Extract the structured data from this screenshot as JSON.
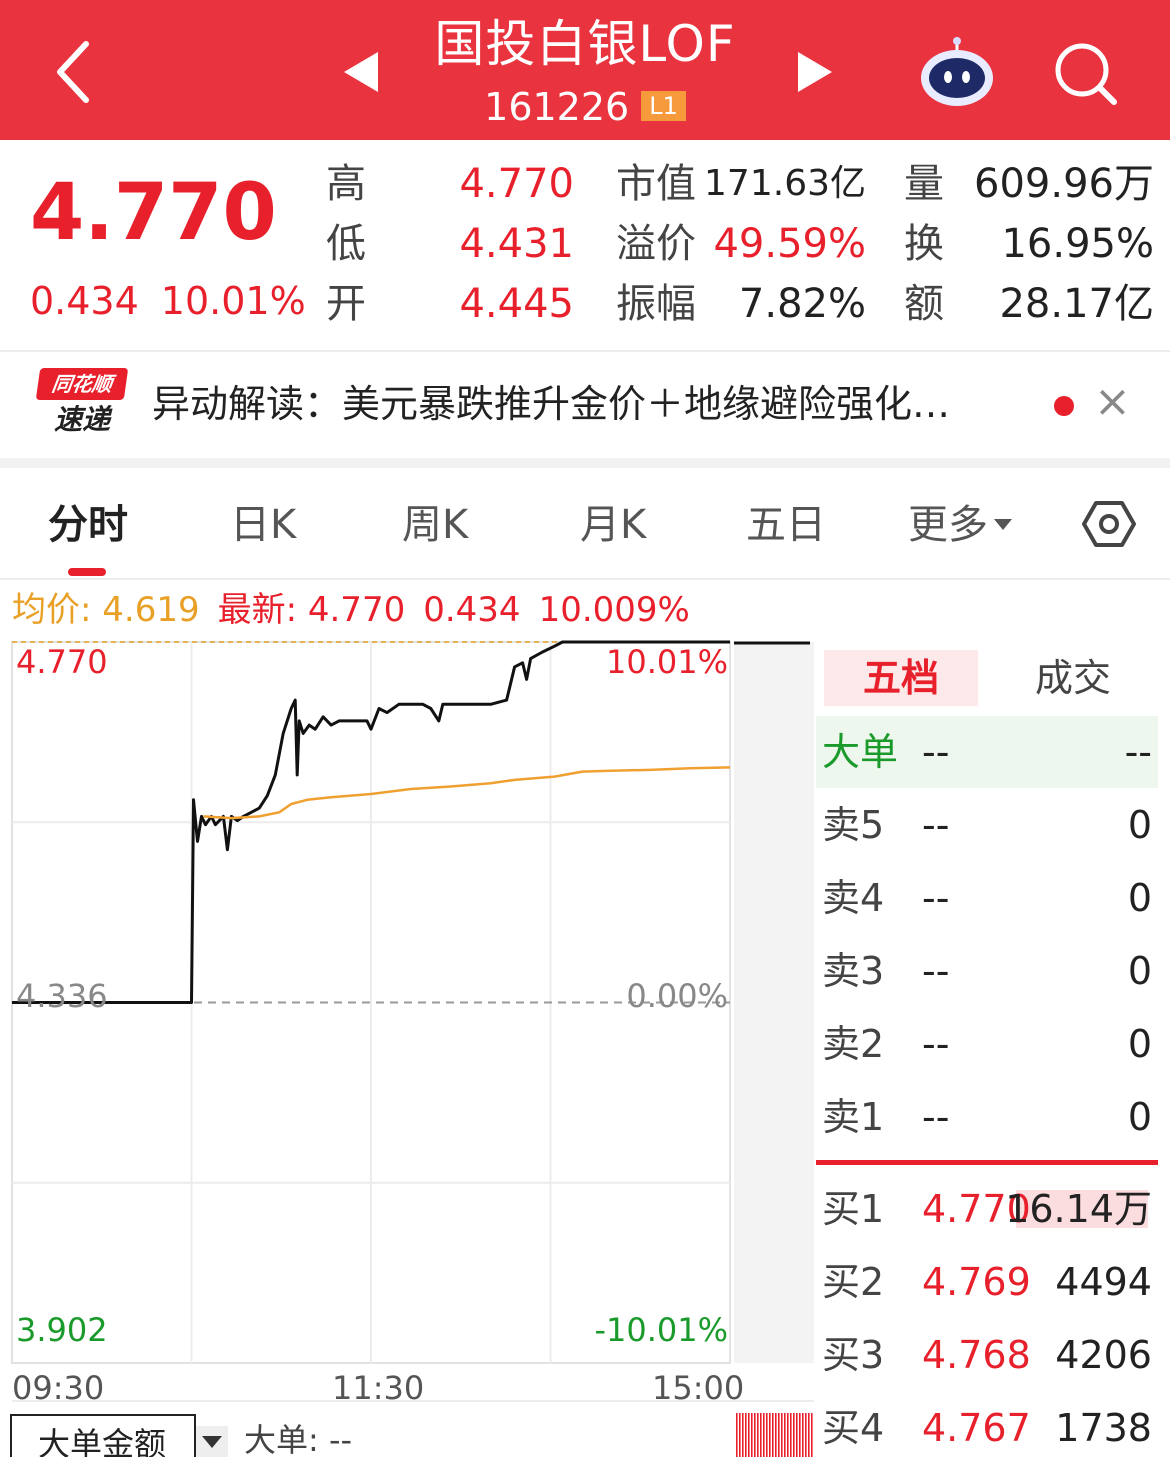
{
  "header": {
    "title": "国投白银LOF",
    "code": "161226",
    "level_badge": "L1"
  },
  "quote": {
    "price": "4.770",
    "change": "0.434",
    "change_pct": "10.01%",
    "stats": [
      {
        "label": "高",
        "value": "4.770"
      },
      {
        "label": "低",
        "value": "4.431"
      },
      {
        "label": "开",
        "value": "4.445"
      },
      {
        "label": "市值",
        "value": "171.63亿"
      },
      {
        "label": "溢价",
        "value": "49.59%"
      },
      {
        "label": "振幅",
        "value": "7.82%"
      },
      {
        "label": "量",
        "value": "609.96万"
      },
      {
        "label": "换",
        "value": "16.95%"
      },
      {
        "label": "额",
        "value": "28.17亿"
      }
    ]
  },
  "news": {
    "logo_top": "同花顺",
    "logo_bottom": "速递",
    "text": "异动解读：美元暴跌推升金价＋地缘避险强化…",
    "close": "×"
  },
  "tabs": [
    "分时",
    "日K",
    "周K",
    "月K",
    "五日",
    "更多"
  ],
  "info_bar": {
    "avg_label": "均价: 4.619",
    "latest_label": "最新: 4.770",
    "change": "0.434",
    "change_pct": "10.009%"
  },
  "chart_data": {
    "type": "line",
    "y_left_labels": [
      "4.770",
      "4.336",
      "3.902"
    ],
    "y_right_labels": [
      "10.01%",
      "0.00%",
      "-10.01%"
    ],
    "x_labels": [
      "09:30",
      "11:30",
      "15:00"
    ],
    "ylim": [
      3.902,
      4.77
    ],
    "prev_close": 4.336,
    "series": [
      {
        "name": "最新",
        "color": "#111111",
        "points": [
          [
            0,
            4.336
          ],
          [
            45,
            4.336
          ],
          [
            45.5,
            4.58
          ],
          [
            46.5,
            4.53
          ],
          [
            47.5,
            4.56
          ],
          [
            48.5,
            4.55
          ],
          [
            50,
            4.56
          ],
          [
            51,
            4.55
          ],
          [
            52,
            4.555
          ],
          [
            53,
            4.56
          ],
          [
            54,
            4.52
          ],
          [
            55,
            4.56
          ],
          [
            56.5,
            4.555
          ],
          [
            58,
            4.56
          ],
          [
            60,
            4.565
          ],
          [
            62,
            4.57
          ],
          [
            64,
            4.585
          ],
          [
            66,
            4.61
          ],
          [
            68,
            4.66
          ],
          [
            70,
            4.69
          ],
          [
            71,
            4.7
          ],
          [
            71.5,
            4.61
          ],
          [
            72,
            4.675
          ],
          [
            73,
            4.66
          ],
          [
            74.5,
            4.67
          ],
          [
            76,
            4.665
          ],
          [
            78,
            4.68
          ],
          [
            80,
            4.67
          ],
          [
            82,
            4.675
          ],
          [
            86,
            4.675
          ],
          [
            89,
            4.675
          ],
          [
            90,
            4.665
          ],
          [
            92,
            4.69
          ],
          [
            94,
            4.685
          ],
          [
            97,
            4.695
          ],
          [
            100,
            4.695
          ],
          [
            103,
            4.695
          ],
          [
            105,
            4.69
          ],
          [
            107,
            4.675
          ],
          [
            108,
            4.695
          ],
          [
            111,
            4.695
          ],
          [
            115,
            4.695
          ],
          [
            120,
            4.695
          ],
          [
            124,
            4.7
          ],
          [
            126,
            4.74
          ],
          [
            128,
            4.745
          ],
          [
            129,
            4.725
          ],
          [
            130,
            4.75
          ],
          [
            133,
            4.758
          ],
          [
            136,
            4.765
          ],
          [
            138,
            4.77
          ],
          [
            150,
            4.77
          ],
          [
            170,
            4.77
          ],
          [
            180,
            4.77
          ]
        ]
      },
      {
        "name": "均价",
        "color": "#f0a030",
        "points": [
          [
            48,
            4.56
          ],
          [
            55,
            4.558
          ],
          [
            62,
            4.56
          ],
          [
            67,
            4.565
          ],
          [
            70,
            4.575
          ],
          [
            74,
            4.58
          ],
          [
            80,
            4.583
          ],
          [
            90,
            4.587
          ],
          [
            100,
            4.593
          ],
          [
            110,
            4.596
          ],
          [
            120,
            4.6
          ],
          [
            126,
            4.604
          ],
          [
            136,
            4.608
          ],
          [
            143,
            4.614
          ],
          [
            150,
            4.615
          ],
          [
            160,
            4.616
          ],
          [
            170,
            4.618
          ],
          [
            180,
            4.619
          ]
        ]
      }
    ],
    "x_range": [
      0,
      180
    ]
  },
  "order_book": {
    "tab_active": "五档",
    "tab_other": "成交",
    "big_order": {
      "label": "大单",
      "price": "--",
      "vol": "--"
    },
    "sell": [
      {
        "label": "卖5",
        "price": "--",
        "vol": "0"
      },
      {
        "label": "卖4",
        "price": "--",
        "vol": "0"
      },
      {
        "label": "卖3",
        "price": "--",
        "vol": "0"
      },
      {
        "label": "卖2",
        "price": "--",
        "vol": "0"
      },
      {
        "label": "卖1",
        "price": "--",
        "vol": "0"
      }
    ],
    "buy": [
      {
        "label": "买1",
        "price": "4.770",
        "vol": "16.14万"
      },
      {
        "label": "买2",
        "price": "4.769",
        "vol": "4494"
      },
      {
        "label": "买3",
        "price": "4.768",
        "vol": "4206"
      },
      {
        "label": "买4",
        "price": "4.767",
        "vol": "1738"
      }
    ]
  },
  "bottom": {
    "tab_label": "大单金额",
    "big_label": "大单: --"
  },
  "colors": {
    "brand": "#e9343f",
    "up": "#e8202c",
    "down": "#1a9a2a",
    "avg": "#f0a030"
  }
}
